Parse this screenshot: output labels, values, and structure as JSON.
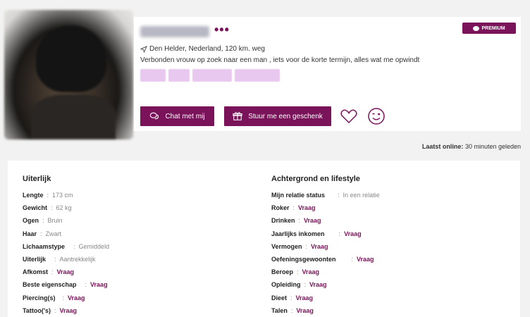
{
  "profile": {
    "location": "Den Helder, Nederland, 120 km. weg",
    "tagline": "Verbonden vrouw op zoek naar een man , iets voor de korte termijn, alles wat me opwindt",
    "more_icon": "more-dots-icon",
    "premium_label": "PREMIUM"
  },
  "actions": {
    "chat_label": "Chat met mij",
    "gift_label": "Stuur me een geschenk"
  },
  "online": {
    "label": "Laatst online:",
    "value": "30 minuten geleden"
  },
  "appearance": {
    "title": "Uiterlijk",
    "rows": [
      {
        "label": "Lengte",
        "value": "173 cm"
      },
      {
        "label": "Gewicht",
        "value": "62 kg"
      },
      {
        "label": "Ogen",
        "value": "Bruin"
      },
      {
        "label": "Haar",
        "value": "Zwart"
      },
      {
        "label": "Lichaamstype",
        "value": "Gemiddeld"
      },
      {
        "label": "Uiterlijk",
        "value": "Aantrekkelijk"
      },
      {
        "label": "Afkomst",
        "ask": "Vraag"
      },
      {
        "label": "Beste eigenschap",
        "ask": "Vraag"
      },
      {
        "label": "Piercing(s)",
        "ask": "Vraag"
      },
      {
        "label": "Tattoo('s)",
        "ask": "Vraag"
      }
    ]
  },
  "lifestyle": {
    "title": "Achtergrond en lifestyle",
    "rows": [
      {
        "label": "Mijn relatie status",
        "value": "In een relatie"
      },
      {
        "label": "Roker",
        "ask": "Vraag"
      },
      {
        "label": "Drinken",
        "ask": "Vraag"
      },
      {
        "label": "Jaarlijks inkomen",
        "ask": "Vraag"
      },
      {
        "label": "Vermogen",
        "ask": "Vraag"
      },
      {
        "label": "Oefeningsgewoonten",
        "ask": "Vraag"
      },
      {
        "label": "Beroep",
        "ask": "Vraag"
      },
      {
        "label": "Opleiding",
        "ask": "Vraag"
      },
      {
        "label": "Dieet",
        "ask": "Vraag"
      },
      {
        "label": "Talen",
        "ask": "Vraag"
      }
    ]
  },
  "colors": {
    "accent": "#7a1359",
    "tag": "#e8c8ee"
  }
}
